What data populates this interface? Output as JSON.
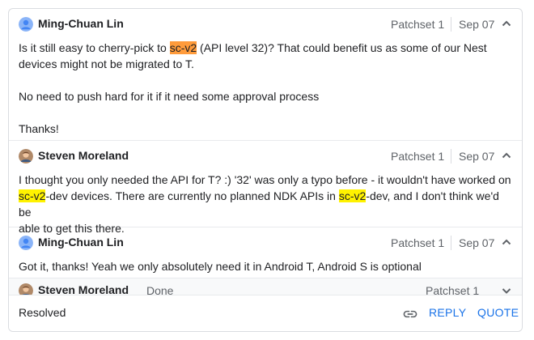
{
  "comments": [
    {
      "author": "Ming-Chuan Lin",
      "patchset": "Patchset 1",
      "date": "Sep 07",
      "avatar_icon": "person-avatar-icon",
      "toggle_icon": "chevron-up-icon",
      "text": {
        "l1_pre": "Is it still easy to cherry-pick to ",
        "l1_hl": "sc-v2",
        "l1_post": " (API level 32)? That could benefit us as some of our Nest",
        "l2": "devices might not be migrated to T.",
        "p2": "No need to push hard for it if it need some approval process",
        "p3": "Thanks!"
      }
    },
    {
      "author": "Steven Moreland",
      "patchset": "Patchset 1",
      "date": "Sep 07",
      "avatar_icon": "photo-avatar-icon",
      "toggle_icon": "chevron-up-icon",
      "text": {
        "l1": "I thought you only needed the API for T? :) '32' was only a typo before - it wouldn't have worked on",
        "l2_hl1": "sc-v2",
        "l2_mid": "-dev devices. There are currently no planned NDK APIs in ",
        "l2_hl2": "sc-v2",
        "l2_post": "-dev, and I don't think we'd be",
        "l3": "able to get this there."
      }
    },
    {
      "author": "Ming-Chuan Lin",
      "patchset": "Patchset 1",
      "date": "Sep 07",
      "avatar_icon": "person-avatar-icon",
      "toggle_icon": "chevron-up-icon",
      "text": "Got it, thanks! Yeah we only absolutely need it in Android T, Android S is optional"
    },
    {
      "author": "Steven Moreland",
      "status": "Done",
      "patchset": "Patchset 1",
      "avatar_icon": "photo-avatar-icon",
      "toggle_icon": "chevron-down-icon"
    }
  ],
  "footer": {
    "status": "Resolved",
    "link_icon": "link-icon",
    "reply_label": "REPLY",
    "quote_label": "QUOTE"
  },
  "colors": {
    "highlight_current": "#ff9b3b",
    "highlight_other": "#fff200",
    "accent": "#1a73e8"
  }
}
